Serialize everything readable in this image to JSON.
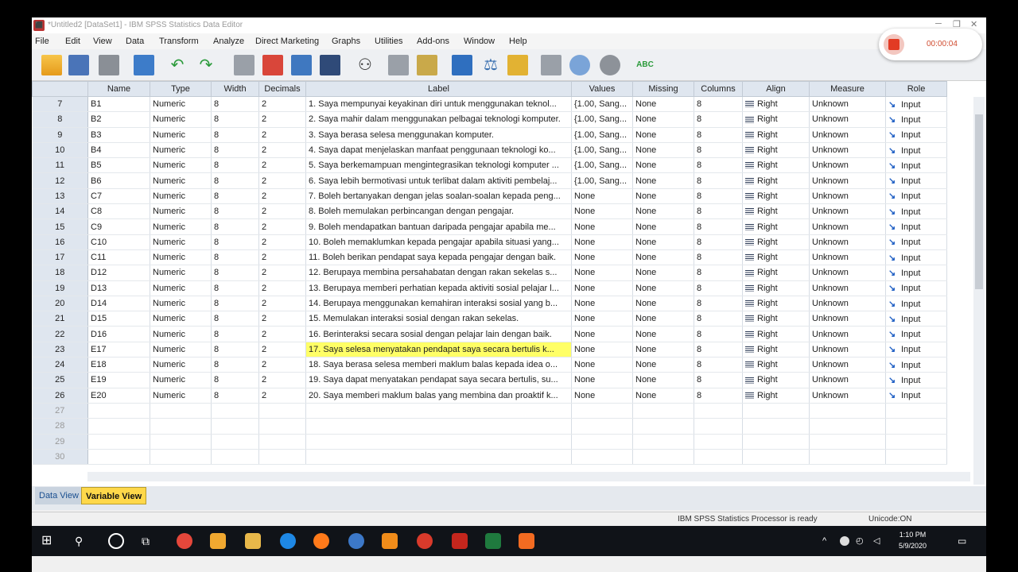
{
  "window": {
    "title": "*Untitled2 [DataSet1] - IBM SPSS Statistics Data Editor"
  },
  "menu": [
    "File",
    "Edit",
    "View",
    "Data",
    "Transform",
    "Analyze",
    "Direct Marketing",
    "Graphs",
    "Utilities",
    "Add-ons",
    "Window",
    "Help"
  ],
  "recorder": {
    "timer": "00:00:04"
  },
  "columns": [
    "Name",
    "Type",
    "Width",
    "Decimals",
    "Label",
    "Values",
    "Missing",
    "Columns",
    "Align",
    "Measure",
    "Role"
  ],
  "rows": [
    {
      "n": "7",
      "name": "B1",
      "type": "Numeric",
      "width": "8",
      "decimals": "2",
      "label": "1. Saya mempunyai keyakinan diri untuk menggunakan teknol...",
      "values": "{1.00, Sang...",
      "missing": "None",
      "columns": "8",
      "align": "Right",
      "measure": "Unknown",
      "role": "Input"
    },
    {
      "n": "8",
      "name": "B2",
      "type": "Numeric",
      "width": "8",
      "decimals": "2",
      "label": "2. Saya mahir dalam menggunakan pelbagai teknologi komputer.",
      "values": "{1.00, Sang...",
      "missing": "None",
      "columns": "8",
      "align": "Right",
      "measure": "Unknown",
      "role": "Input"
    },
    {
      "n": "9",
      "name": "B3",
      "type": "Numeric",
      "width": "8",
      "decimals": "2",
      "label": "3. Saya berasa selesa menggunakan komputer.",
      "values": "{1.00, Sang...",
      "missing": "None",
      "columns": "8",
      "align": "Right",
      "measure": "Unknown",
      "role": "Input"
    },
    {
      "n": "10",
      "name": "B4",
      "type": "Numeric",
      "width": "8",
      "decimals": "2",
      "label": "4. Saya dapat menjelaskan manfaat penggunaan teknologi ko...",
      "values": "{1.00, Sang...",
      "missing": "None",
      "columns": "8",
      "align": "Right",
      "measure": "Unknown",
      "role": "Input"
    },
    {
      "n": "11",
      "name": "B5",
      "type": "Numeric",
      "width": "8",
      "decimals": "2",
      "label": "5. Saya berkemampuan mengintegrasikan teknologi komputer ...",
      "values": "{1.00, Sang...",
      "missing": "None",
      "columns": "8",
      "align": "Right",
      "measure": "Unknown",
      "role": "Input"
    },
    {
      "n": "12",
      "name": "B6",
      "type": "Numeric",
      "width": "8",
      "decimals": "2",
      "label": "6. Saya lebih bermotivasi untuk terlibat dalam aktiviti pembelaj...",
      "values": "{1.00, Sang...",
      "missing": "None",
      "columns": "8",
      "align": "Right",
      "measure": "Unknown",
      "role": "Input"
    },
    {
      "n": "13",
      "name": "C7",
      "type": "Numeric",
      "width": "8",
      "decimals": "2",
      "label": "7. Boleh bertanyakan dengan jelas soalan-soalan kepada peng...",
      "values": "None",
      "missing": "None",
      "columns": "8",
      "align": "Right",
      "measure": "Unknown",
      "role": "Input"
    },
    {
      "n": "14",
      "name": "C8",
      "type": "Numeric",
      "width": "8",
      "decimals": "2",
      "label": "8. Boleh memulakan perbincangan dengan pengajar.",
      "values": "None",
      "missing": "None",
      "columns": "8",
      "align": "Right",
      "measure": "Unknown",
      "role": "Input"
    },
    {
      "n": "15",
      "name": "C9",
      "type": "Numeric",
      "width": "8",
      "decimals": "2",
      "label": "9. Boleh mendapatkan bantuan daripada pengajar apabila me...",
      "values": "None",
      "missing": "None",
      "columns": "8",
      "align": "Right",
      "measure": "Unknown",
      "role": "Input"
    },
    {
      "n": "16",
      "name": "C10",
      "type": "Numeric",
      "width": "8",
      "decimals": "2",
      "label": "10. Boleh memaklumkan kepada pengajar apabila situasi yang...",
      "values": "None",
      "missing": "None",
      "columns": "8",
      "align": "Right",
      "measure": "Unknown",
      "role": "Input"
    },
    {
      "n": "17",
      "name": "C11",
      "type": "Numeric",
      "width": "8",
      "decimals": "2",
      "label": "11. Boleh berikan pendapat saya kepada pengajar dengan baik.",
      "values": "None",
      "missing": "None",
      "columns": "8",
      "align": "Right",
      "measure": "Unknown",
      "role": "Input"
    },
    {
      "n": "18",
      "name": "D12",
      "type": "Numeric",
      "width": "8",
      "decimals": "2",
      "label": "12. Berupaya membina persahabatan dengan rakan sekelas s...",
      "values": "None",
      "missing": "None",
      "columns": "8",
      "align": "Right",
      "measure": "Unknown",
      "role": "Input"
    },
    {
      "n": "19",
      "name": "D13",
      "type": "Numeric",
      "width": "8",
      "decimals": "2",
      "label": "13. Berupaya memberi perhatian kepada aktiviti sosial pelajar l...",
      "values": "None",
      "missing": "None",
      "columns": "8",
      "align": "Right",
      "measure": "Unknown",
      "role": "Input"
    },
    {
      "n": "20",
      "name": "D14",
      "type": "Numeric",
      "width": "8",
      "decimals": "2",
      "label": "14. Berupaya menggunakan kemahiran interaksi sosial yang b...",
      "values": "None",
      "missing": "None",
      "columns": "8",
      "align": "Right",
      "measure": "Unknown",
      "role": "Input"
    },
    {
      "n": "21",
      "name": "D15",
      "type": "Numeric",
      "width": "8",
      "decimals": "2",
      "label": "15. Memulakan interaksi sosial dengan rakan sekelas.",
      "values": "None",
      "missing": "None",
      "columns": "8",
      "align": "Right",
      "measure": "Unknown",
      "role": "Input"
    },
    {
      "n": "22",
      "name": "D16",
      "type": "Numeric",
      "width": "8",
      "decimals": "2",
      "label": "16. Berinteraksi secara sosial dengan pelajar lain dengan baik.",
      "values": "None",
      "missing": "None",
      "columns": "8",
      "align": "Right",
      "measure": "Unknown",
      "role": "Input"
    },
    {
      "n": "23",
      "name": "E17",
      "type": "Numeric",
      "width": "8",
      "decimals": "2",
      "label": "17. Saya selesa menyatakan pendapat saya secara bertulis k...",
      "values": "None",
      "missing": "None",
      "columns": "8",
      "align": "Right",
      "measure": "Unknown",
      "role": "Input",
      "highlight": true
    },
    {
      "n": "24",
      "name": "E18",
      "type": "Numeric",
      "width": "8",
      "decimals": "2",
      "label": "18. Saya berasa selesa memberi maklum balas kepada idea o...",
      "values": "None",
      "missing": "None",
      "columns": "8",
      "align": "Right",
      "measure": "Unknown",
      "role": "Input"
    },
    {
      "n": "25",
      "name": "E19",
      "type": "Numeric",
      "width": "8",
      "decimals": "2",
      "label": "19. Saya dapat menyatakan pendapat saya secara bertulis, su...",
      "values": "None",
      "missing": "None",
      "columns": "8",
      "align": "Right",
      "measure": "Unknown",
      "role": "Input"
    },
    {
      "n": "26",
      "name": "E20",
      "type": "Numeric",
      "width": "8",
      "decimals": "2",
      "label": "20. Saya memberi maklum balas yang membina dan proaktif k...",
      "values": "None",
      "missing": "None",
      "columns": "8",
      "align": "Right",
      "measure": "Unknown",
      "role": "Input"
    }
  ],
  "empty_rows": [
    "27",
    "28",
    "29",
    "30"
  ],
  "tabs": {
    "data_view": "Data View",
    "variable_view": "Variable View"
  },
  "status": {
    "processor": "IBM SPSS Statistics Processor is ready",
    "unicode": "Unicode:ON"
  },
  "clock": {
    "time": "1:10 PM",
    "date": "5/9/2020"
  },
  "colors": {
    "highlight": "#ffff66",
    "active_tab": "#ffd84a",
    "header_bg": "#dfe6ef"
  }
}
